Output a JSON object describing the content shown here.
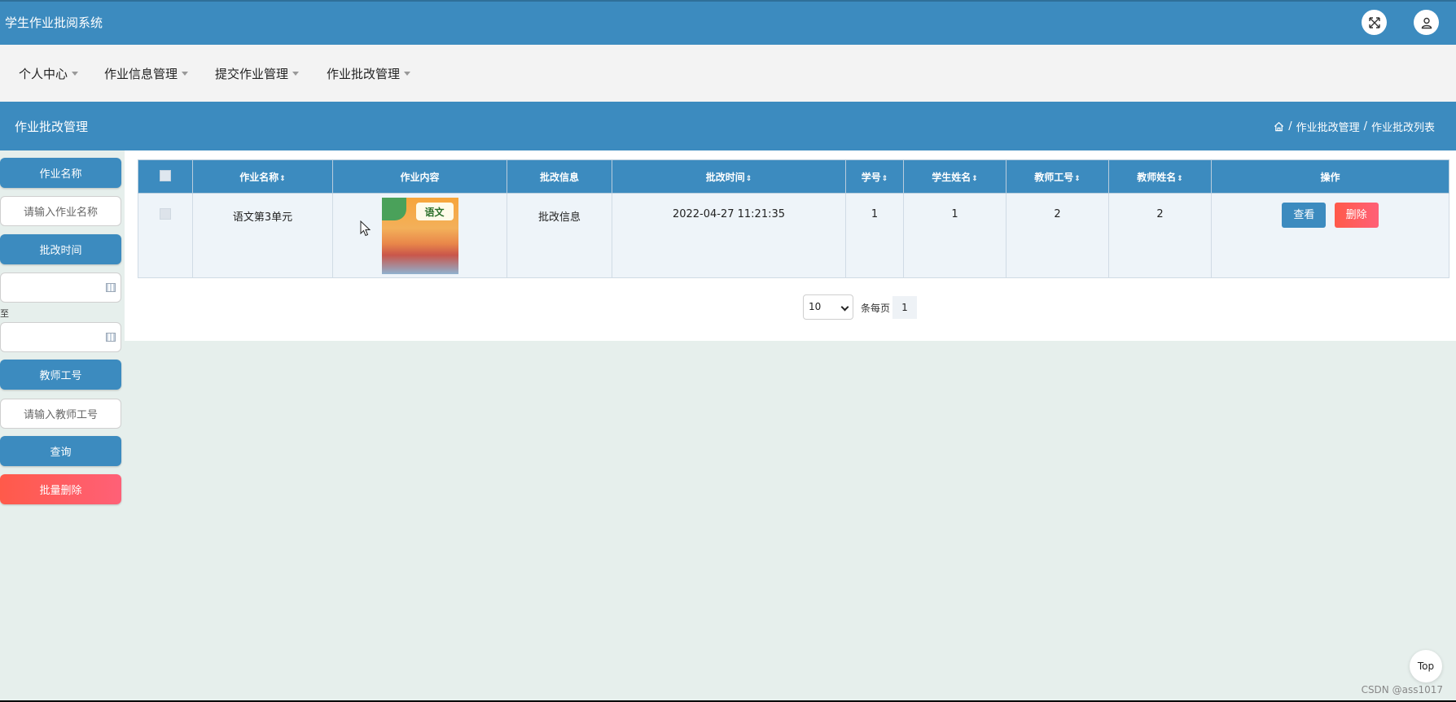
{
  "app": {
    "title": "学生作业批阅系统"
  },
  "header_icons": {
    "fullscreen": "fullscreen-icon",
    "user": "user-icon"
  },
  "nav": {
    "items": [
      {
        "label": "个人中心"
      },
      {
        "label": "作业信息管理"
      },
      {
        "label": "提交作业管理"
      },
      {
        "label": "作业批改管理"
      }
    ]
  },
  "section": {
    "title": "作业批改管理",
    "breadcrumb": {
      "sep1": "/",
      "crumb1": "作业批改管理",
      "sep2": "/",
      "crumb2": "作业批改列表"
    }
  },
  "search": {
    "homework_name_label": "作业名称",
    "homework_name_placeholder": "请输入作业名称",
    "review_time_label": "批改时间",
    "to_label": "至",
    "teacher_no_label": "教师工号",
    "teacher_no_placeholder": "请输入教师工号",
    "query_button": "查询",
    "batch_delete_button": "批量删除"
  },
  "table": {
    "columns": {
      "name": "作业名称",
      "content": "作业内容",
      "review_info": "批改信息",
      "review_time": "批改时间",
      "student_no": "学号",
      "student_name": "学生姓名",
      "teacher_no": "教师工号",
      "teacher_name": "教师姓名",
      "actions": "操作"
    },
    "sort_symbol": "⇕",
    "rows": [
      {
        "name": "语文第3单元",
        "content_image_label": "语文",
        "review_info": "批改信息",
        "review_time": "2022-04-27 11:21:35",
        "student_no": "1",
        "student_name": "1",
        "teacher_no": "2",
        "teacher_name": "2",
        "view_label": "查看",
        "delete_label": "删除"
      }
    ]
  },
  "pagination": {
    "page_size": "10",
    "per_page_label": "条每页",
    "current_page": "1"
  },
  "top_button": "Top",
  "watermark": "CSDN @ass1017",
  "colors": {
    "primary": "#3c8bbf",
    "danger": "#ff5a4a",
    "background": "#e6efec"
  }
}
